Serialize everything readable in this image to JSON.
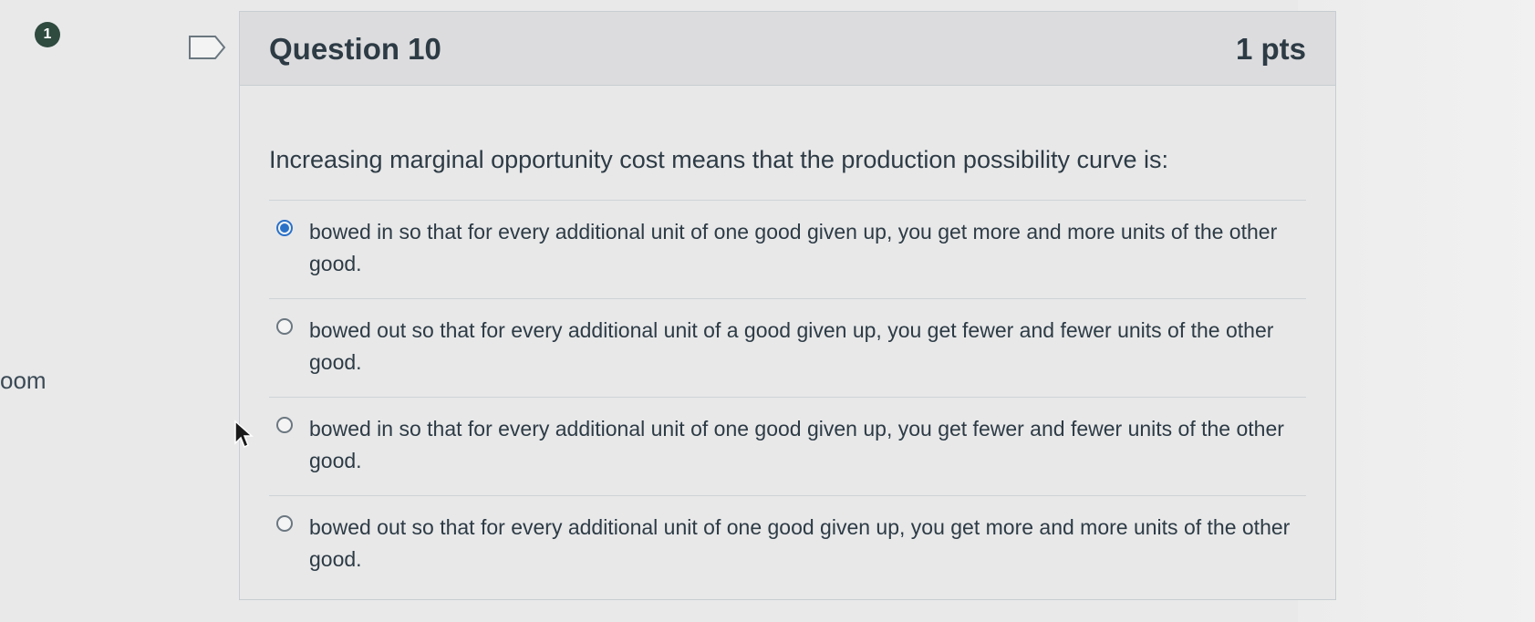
{
  "nav": {
    "badge": "1",
    "side_text": "oom"
  },
  "question": {
    "title": "Question 10",
    "points": "1 pts",
    "text": "Increasing marginal opportunity cost means that the production possibility curve is:",
    "answers": [
      {
        "label": "bowed in so that for every additional unit of one good given up, you get more and more units of the other good.",
        "selected": true
      },
      {
        "label": "bowed out so that for every additional unit of a good given up, you get fewer and fewer units of the other good.",
        "selected": false
      },
      {
        "label": "bowed in so that for every additional unit of one good given up, you get fewer and fewer units of the other good.",
        "selected": false
      },
      {
        "label": "bowed out so that for every additional unit of one good given up, you get more and more units of the other good.",
        "selected": false
      }
    ]
  },
  "colors": {
    "accent": "#2b71c8",
    "badge": "#2f4a3f",
    "header_bg": "#dcdcde"
  }
}
